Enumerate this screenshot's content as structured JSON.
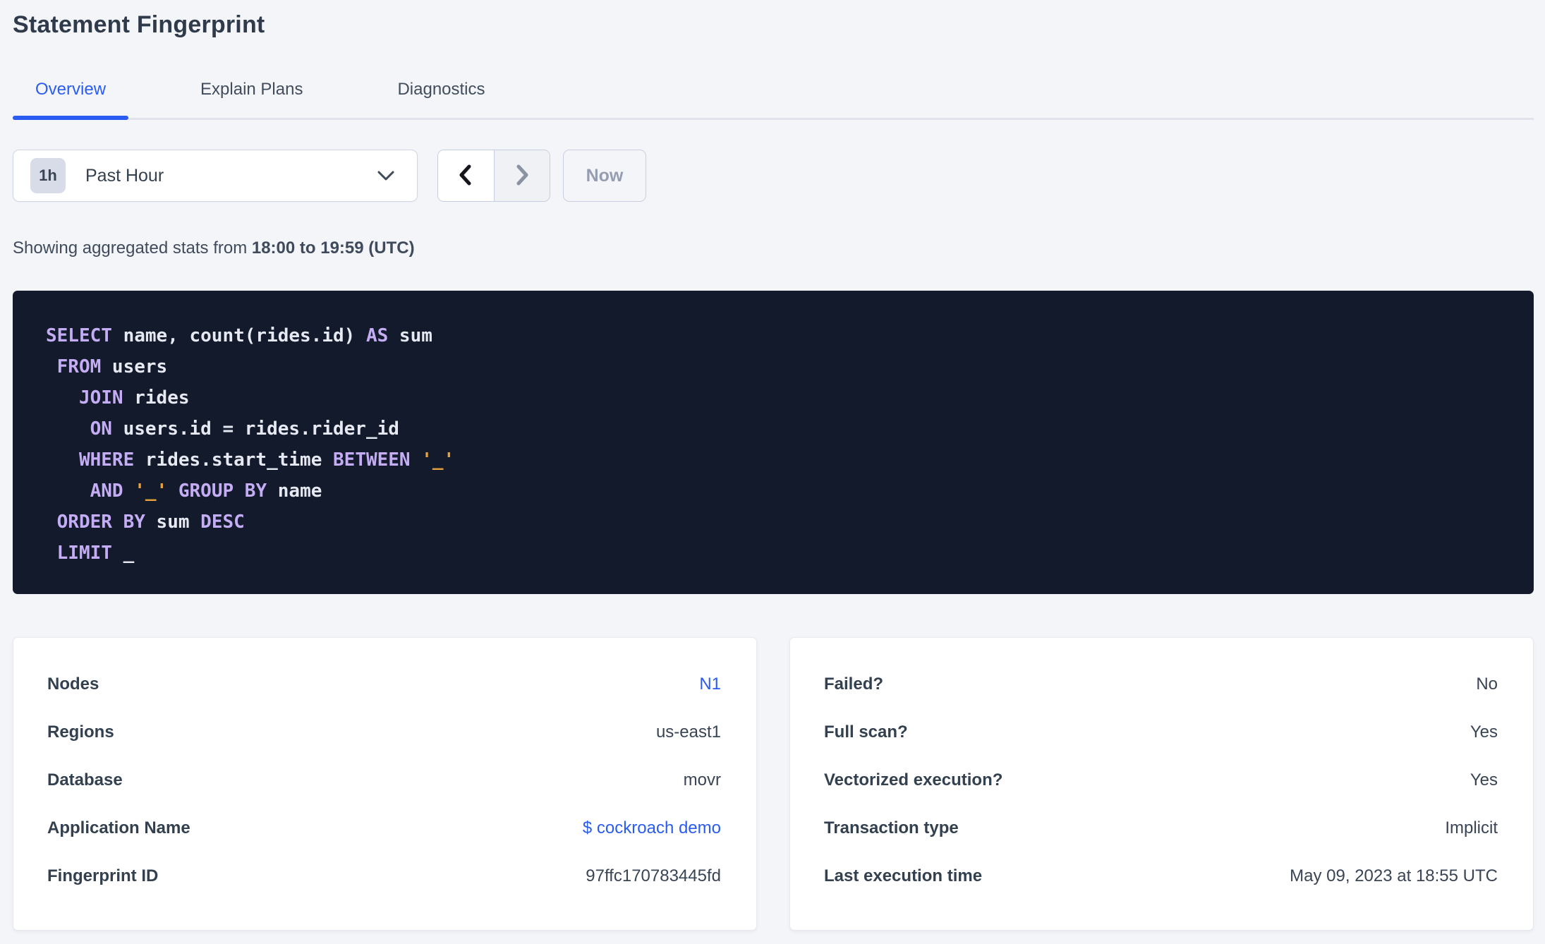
{
  "page": {
    "title": "Statement Fingerprint"
  },
  "tabs": [
    {
      "label": "Overview",
      "active": true
    },
    {
      "label": "Explain Plans",
      "active": false
    },
    {
      "label": "Diagnostics",
      "active": false
    }
  ],
  "time_picker": {
    "range_badge": "1h",
    "range_label": "Past Hour",
    "now_label": "Now",
    "icons": [
      "chevron-down-icon",
      "chevron-left-icon",
      "chevron-right-icon"
    ]
  },
  "subtitle": {
    "prefix": "Showing aggregated stats from ",
    "range_bold": "18:00 to 19:59 (UTC)"
  },
  "sql": {
    "lines": [
      [
        {
          "t": "SELECT",
          "c": "kw"
        },
        {
          "t": " name, count(rides.id) ",
          "c": "id"
        },
        {
          "t": "AS",
          "c": "kw"
        },
        {
          "t": " sum",
          "c": "id"
        }
      ],
      [
        {
          "t": " ",
          "c": "id"
        },
        {
          "t": "FROM",
          "c": "kw"
        },
        {
          "t": " users",
          "c": "id"
        }
      ],
      [
        {
          "t": "   ",
          "c": "id"
        },
        {
          "t": "JOIN",
          "c": "kw"
        },
        {
          "t": " rides",
          "c": "id"
        }
      ],
      [
        {
          "t": "    ",
          "c": "id"
        },
        {
          "t": "ON",
          "c": "kw"
        },
        {
          "t": " users.id = rides.rider_id",
          "c": "id"
        }
      ],
      [
        {
          "t": "   ",
          "c": "id"
        },
        {
          "t": "WHERE",
          "c": "kw"
        },
        {
          "t": " rides.start_time ",
          "c": "id"
        },
        {
          "t": "BETWEEN",
          "c": "kw"
        },
        {
          "t": " ",
          "c": "id"
        },
        {
          "t": "'_'",
          "c": "str"
        }
      ],
      [
        {
          "t": "    ",
          "c": "id"
        },
        {
          "t": "AND",
          "c": "kw"
        },
        {
          "t": " ",
          "c": "id"
        },
        {
          "t": "'_'",
          "c": "str"
        },
        {
          "t": " ",
          "c": "id"
        },
        {
          "t": "GROUP BY",
          "c": "kw"
        },
        {
          "t": " name",
          "c": "id"
        }
      ],
      [
        {
          "t": " ",
          "c": "id"
        },
        {
          "t": "ORDER BY",
          "c": "kw"
        },
        {
          "t": " sum ",
          "c": "id"
        },
        {
          "t": "DESC",
          "c": "kw"
        }
      ],
      [
        {
          "t": " ",
          "c": "id"
        },
        {
          "t": "LIMIT",
          "c": "kw"
        },
        {
          "t": " _",
          "c": "id"
        }
      ]
    ]
  },
  "cards": {
    "left": {
      "rows": [
        {
          "label": "Nodes",
          "value": "N1",
          "link": true
        },
        {
          "label": "Regions",
          "value": "us-east1",
          "link": false
        },
        {
          "label": "Database",
          "value": "movr",
          "link": false
        },
        {
          "label": "Application Name",
          "value": "$ cockroach demo",
          "link": true
        },
        {
          "label": "Fingerprint ID",
          "value": "97ffc170783445fd",
          "link": false
        }
      ]
    },
    "right": {
      "rows": [
        {
          "label": "Failed?",
          "value": "No",
          "link": false
        },
        {
          "label": "Full scan?",
          "value": "Yes",
          "link": false
        },
        {
          "label": "Vectorized execution?",
          "value": "Yes",
          "link": false
        },
        {
          "label": "Transaction type",
          "value": "Implicit",
          "link": false
        },
        {
          "label": "Last execution time",
          "value": "May 09, 2023 at 18:55 UTC",
          "link": false
        }
      ]
    }
  },
  "colors": {
    "page_background": "#f4f5f9",
    "accent_blue": "#2b5cf2",
    "text_dark": "#394455",
    "disabled_text": "#959db0",
    "sql_background": "#121a2b",
    "sql_keyword": "#c4adf4",
    "sql_identifier": "#e7e9f2",
    "sql_string": "#e8a23c"
  }
}
